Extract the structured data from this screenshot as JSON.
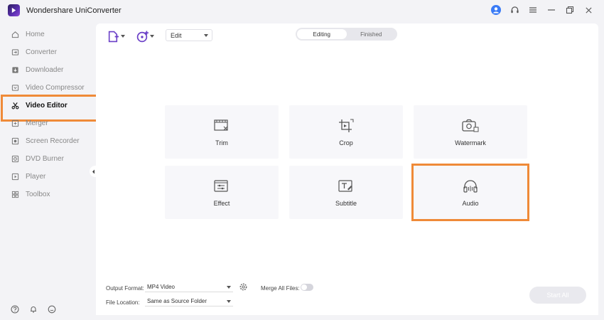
{
  "window": {
    "title": "Wondershare UniConverter"
  },
  "sidebar": {
    "items": [
      {
        "label": "Home",
        "icon": "home-icon"
      },
      {
        "label": "Converter",
        "icon": "converter-icon"
      },
      {
        "label": "Downloader",
        "icon": "downloader-icon"
      },
      {
        "label": "Video Compressor",
        "icon": "compressor-icon"
      },
      {
        "label": "Video Editor",
        "icon": "scissors-icon",
        "active": true
      },
      {
        "label": "Merger",
        "icon": "merger-icon"
      },
      {
        "label": "Screen Recorder",
        "icon": "screen-recorder-icon"
      },
      {
        "label": "DVD Burner",
        "icon": "dvd-icon"
      },
      {
        "label": "Player",
        "icon": "player-icon"
      },
      {
        "label": "Toolbox",
        "icon": "toolbox-icon"
      }
    ]
  },
  "toolbar": {
    "edit_select": "Edit",
    "tabs": [
      {
        "label": "Editing",
        "active": true
      },
      {
        "label": "Finished",
        "active": false
      }
    ]
  },
  "features": [
    {
      "label": "Trim",
      "icon": "trim-icon"
    },
    {
      "label": "Crop",
      "icon": "crop-icon"
    },
    {
      "label": "Watermark",
      "icon": "watermark-icon"
    },
    {
      "label": "Effect",
      "icon": "effect-icon"
    },
    {
      "label": "Subtitle",
      "icon": "subtitle-icon"
    },
    {
      "label": "Audio",
      "icon": "audio-icon",
      "highlighted": true
    }
  ],
  "bottom": {
    "output_format_label": "Output Format:",
    "output_format_value": "MP4 Video",
    "merge_label": "Merge All Files:",
    "merge_enabled": false,
    "file_location_label": "File Location:",
    "file_location_value": "Same as Source Folder",
    "start_all_label": "Start All"
  },
  "colors": {
    "highlight": "#ef8a38",
    "accent_purple": "#6a3fc7",
    "avatar_blue": "#3a7bf6"
  }
}
